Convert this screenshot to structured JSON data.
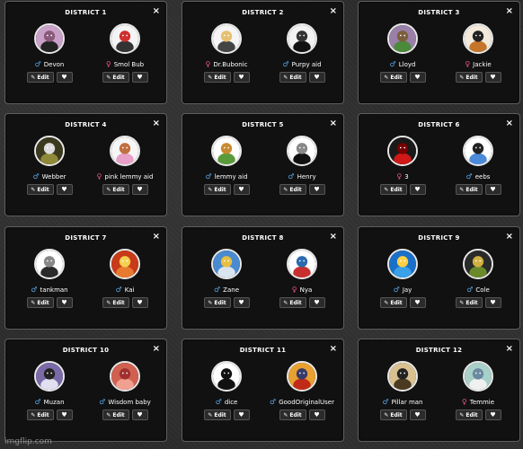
{
  "labels": {
    "edit": "Edit",
    "heart_glyph": "♥",
    "close_glyph": "×",
    "edit_glyph": "✎",
    "male_glyph": "♂",
    "female_glyph": "♀"
  },
  "districts": [
    {
      "title": "DISTRICT 1",
      "tributes": [
        {
          "name": "Devon",
          "gender": "male",
          "avatar": "hat-man-icon",
          "colors": [
            "#c9a0c8",
            "#222",
            "#8a5a7a"
          ]
        },
        {
          "name": "Smol Bub",
          "gender": "female",
          "avatar": "bubble-icon",
          "colors": [
            "#f4f4f4",
            "#333",
            "#d03030"
          ]
        }
      ]
    },
    {
      "title": "DISTRICT 2",
      "tributes": [
        {
          "name": "Dr.Bubonic",
          "gender": "female",
          "avatar": "anime-girl-icon",
          "colors": [
            "#f5f5f5",
            "#444",
            "#e6c070"
          ]
        },
        {
          "name": "Purpy aid",
          "gender": "male",
          "avatar": "black-figure-icon",
          "colors": [
            "#f2f2f2",
            "#111",
            "#333"
          ]
        }
      ]
    },
    {
      "title": "DISTRICT 3",
      "tributes": [
        {
          "name": "Lloyd",
          "gender": "male",
          "avatar": "green-ninja-icon",
          "colors": [
            "#9a7fa8",
            "#4b8a3a",
            "#7b5f3c"
          ]
        },
        {
          "name": "Jackie",
          "gender": "female",
          "avatar": "fox-icon",
          "colors": [
            "#f3eadb",
            "#c4752a",
            "#222"
          ]
        }
      ]
    },
    {
      "title": "DISTRICT 4",
      "tributes": [
        {
          "name": "Webber",
          "gender": "male",
          "avatar": "text-badge-icon",
          "colors": [
            "#3c3a1e",
            "#8e8a3a",
            "#ddd"
          ]
        },
        {
          "name": "pink lemmy aid",
          "gender": "female",
          "avatar": "pink-figure-icon",
          "colors": [
            "#f6f6f6",
            "#e8a0c8",
            "#c07040"
          ]
        }
      ]
    },
    {
      "title": "DISTRICT 5",
      "tributes": [
        {
          "name": "lemmy aid",
          "gender": "male",
          "avatar": "bottle-icon",
          "colors": [
            "#ffffff",
            "#5a9a3a",
            "#c88a30"
          ]
        },
        {
          "name": "Henry",
          "gender": "male",
          "avatar": "stickman-icon",
          "colors": [
            "#ffffff",
            "#111",
            "#888"
          ]
        }
      ]
    },
    {
      "title": "DISTRICT 6",
      "tributes": [
        {
          "name": "3",
          "gender": "female",
          "avatar": "red-door-icon",
          "colors": [
            "#1a1a1a",
            "#d01818",
            "#700"
          ]
        },
        {
          "name": "eebs",
          "gender": "male",
          "avatar": "blue-robot-icon",
          "colors": [
            "#ffffff",
            "#4a8ad8",
            "#222"
          ]
        }
      ]
    },
    {
      "title": "DISTRICT 7",
      "tributes": [
        {
          "name": "tankman",
          "gender": "male",
          "avatar": "tank-icon",
          "colors": [
            "#ffffff",
            "#2a2a2a",
            "#888"
          ]
        },
        {
          "name": "Kai",
          "gender": "male",
          "avatar": "red-ninja-icon",
          "colors": [
            "#c83a18",
            "#e87a30",
            "#f4d050"
          ]
        }
      ]
    },
    {
      "title": "DISTRICT 8",
      "tributes": [
        {
          "name": "Zane",
          "gender": "male",
          "avatar": "white-ninja-icon",
          "colors": [
            "#4a8ad0",
            "#d8e4ee",
            "#e8c040"
          ]
        },
        {
          "name": "Nya",
          "gender": "female",
          "avatar": "water-ninja-icon",
          "colors": [
            "#ffffff",
            "#c83030",
            "#2a6ab0"
          ]
        }
      ]
    },
    {
      "title": "DISTRICT 9",
      "tributes": [
        {
          "name": "Jay",
          "gender": "male",
          "avatar": "blue-ninja-icon",
          "colors": [
            "#1a70c8",
            "#3aa0e8",
            "#ffd040"
          ]
        },
        {
          "name": "Cole",
          "gender": "male",
          "avatar": "black-ninja-icon",
          "colors": [
            "#2a2a2a",
            "#6a8a2a",
            "#d0b040"
          ]
        }
      ]
    },
    {
      "title": "DISTRICT 10",
      "tributes": [
        {
          "name": "Muzan",
          "gender": "male",
          "avatar": "dark-portrait-icon",
          "colors": [
            "#7a6aa8",
            "#e0e0f0",
            "#222"
          ]
        },
        {
          "name": "Wisdom baby",
          "gender": "male",
          "avatar": "baby-face-icon",
          "colors": [
            "#d06050",
            "#f0a090",
            "#a03030"
          ]
        }
      ]
    },
    {
      "title": "DISTRICT 11",
      "tributes": [
        {
          "name": "dice",
          "gender": "male",
          "avatar": "dice-icon",
          "colors": [
            "#ffffff",
            "#111",
            "#111"
          ]
        },
        {
          "name": "GoodOriginalUser",
          "gender": "male",
          "avatar": "shadow-figure-icon",
          "colors": [
            "#e8a030",
            "#c02a18",
            "#3a3a6a"
          ]
        }
      ]
    },
    {
      "title": "DISTRICT 12",
      "tributes": [
        {
          "name": "Pillar man",
          "gender": "male",
          "avatar": "pillar-man-icon",
          "colors": [
            "#d8c090",
            "#4a3a20",
            "#222"
          ]
        },
        {
          "name": "Temmie",
          "gender": "female",
          "avatar": "temmie-icon",
          "colors": [
            "#a8d0c8",
            "#f0f0f0",
            "#6a8aa0"
          ]
        }
      ]
    }
  ],
  "watermark": "imgflip.com"
}
